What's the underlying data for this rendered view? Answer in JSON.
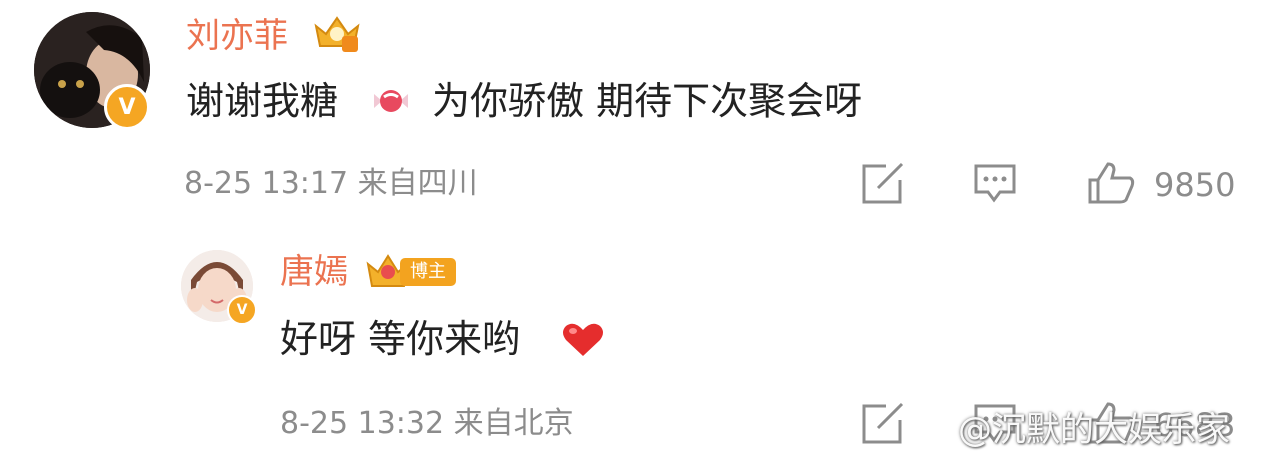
{
  "comments": [
    {
      "username": "刘亦菲",
      "text_before_emoji": "谢谢我糖",
      "emoji": "candy-emoji",
      "text_after_emoji": "为你骄傲 期待下次聚会呀",
      "timestamp": "8-25 13:17 来自四川",
      "likes": "9850",
      "badge": "V"
    },
    {
      "username": "唐嫣",
      "tag": "博主",
      "text": "好呀 等你来哟",
      "emoji": "red-heart-emoji",
      "timestamp": "8-25 13:32 来自北京",
      "likes": "6683",
      "badge": "V"
    }
  ],
  "watermark": "@沉默的大娱乐家",
  "colors": {
    "username": "#eb7350",
    "meta": "#8c8c8c",
    "badge": "#f5a623",
    "text": "#222222"
  }
}
